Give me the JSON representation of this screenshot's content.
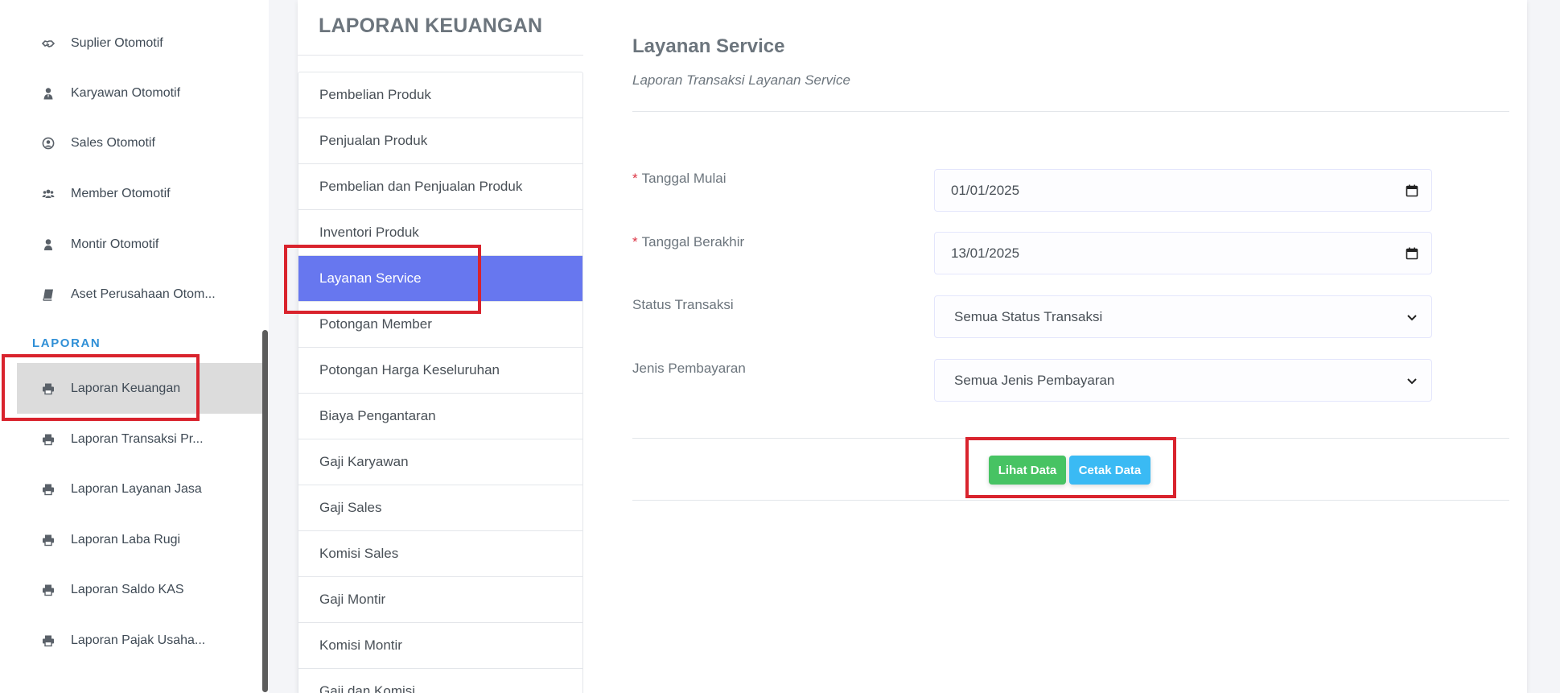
{
  "sidebar": {
    "items": [
      {
        "label": "Suplier Otomotif",
        "icon": "handshake-icon"
      },
      {
        "label": "Karyawan Otomotif",
        "icon": "user-tie-icon"
      },
      {
        "label": "Sales Otomotif",
        "icon": "user-circle-icon"
      },
      {
        "label": "Member Otomotif",
        "icon": "users-icon"
      },
      {
        "label": "Montir Otomotif",
        "icon": "user-icon"
      },
      {
        "label": "Aset Perusahaan Otom...",
        "icon": "book-icon"
      }
    ],
    "section_label": "LAPORAN",
    "report_items": [
      {
        "label": "Laporan Keuangan",
        "icon": "print-icon"
      },
      {
        "label": "Laporan Transaksi Pr...",
        "icon": "print-icon"
      },
      {
        "label": "Laporan Layanan Jasa",
        "icon": "print-icon"
      },
      {
        "label": "Laporan Laba Rugi",
        "icon": "print-icon"
      },
      {
        "label": "Laporan Saldo KAS",
        "icon": "print-icon"
      },
      {
        "label": "Laporan Pajak Usaha...",
        "icon": "print-icon"
      }
    ],
    "active_item": "Laporan Keuangan"
  },
  "report_menu": {
    "title": "LAPORAN KEUANGAN",
    "items": [
      "Pembelian Produk",
      "Penjualan Produk",
      "Pembelian dan Penjualan Produk",
      "Inventori Produk",
      "Layanan Service",
      "Potongan Member",
      "Potongan Harga Keseluruhan",
      "Biaya Pengantaran",
      "Gaji Karyawan",
      "Gaji Sales",
      "Komisi Sales",
      "Gaji Montir",
      "Komisi Montir",
      "Gaji dan Komisi"
    ],
    "active_item": "Layanan Service"
  },
  "content": {
    "title": "Layanan Service",
    "subtitle": "Laporan Transaksi Layanan Service",
    "fields": {
      "start_date": {
        "label": "Tanggal Mulai",
        "required": "*",
        "value": "01/01/2025"
      },
      "end_date": {
        "label": "Tanggal Berakhir",
        "required": "*",
        "value": "13/01/2025"
      },
      "status": {
        "label": "Status Transaksi",
        "value": "Semua Status Transaksi"
      },
      "payment": {
        "label": "Jenis Pembayaran",
        "value": "Semua Jenis Pembayaran"
      }
    },
    "buttons": {
      "view": "Lihat Data",
      "print": "Cetak Data"
    }
  },
  "colors": {
    "accent": "#6777ef",
    "section_label": "#2f8fd6",
    "required": "#dc3545",
    "button_green": "#47c363",
    "button_blue": "#3abaf4",
    "highlight": "#d9232d"
  }
}
